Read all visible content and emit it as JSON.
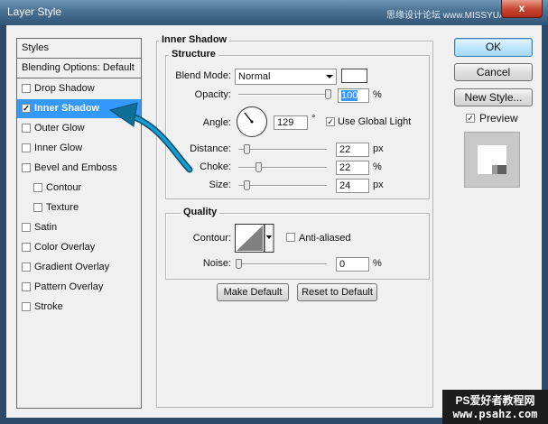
{
  "window": {
    "title": "Layer Style",
    "watermark": "思缘设计论坛  www.MISSYUAN.COM",
    "close_glyph": "x"
  },
  "styles_panel": {
    "header": "Styles",
    "blending": "Blending Options: Default",
    "items": [
      {
        "label": "Drop Shadow",
        "checked": false
      },
      {
        "label": "Inner Shadow",
        "checked": true,
        "selected": true
      },
      {
        "label": "Outer Glow",
        "checked": false
      },
      {
        "label": "Inner Glow",
        "checked": false
      },
      {
        "label": "Bevel and Emboss",
        "checked": false
      },
      {
        "label": "Contour",
        "checked": false,
        "indent": true
      },
      {
        "label": "Texture",
        "checked": false,
        "indent": true
      },
      {
        "label": "Satin",
        "checked": false
      },
      {
        "label": "Color Overlay",
        "checked": false
      },
      {
        "label": "Gradient Overlay",
        "checked": false
      },
      {
        "label": "Pattern Overlay",
        "checked": false
      },
      {
        "label": "Stroke",
        "checked": false
      }
    ]
  },
  "inner_shadow": {
    "title": "Inner Shadow",
    "structure": {
      "title": "Structure",
      "blend_mode_label": "Blend Mode:",
      "blend_mode_value": "Normal",
      "shadow_color": "#ffffff",
      "opacity_label": "Opacity:",
      "opacity_value": "100",
      "opacity_unit": "%",
      "opacity_level": 1.0,
      "angle_label": "Angle:",
      "angle_value": "129",
      "angle_unit": "°",
      "angle_degrees": 129,
      "use_global_light_label": "Use Global Light",
      "use_global_light": true,
      "distance_label": "Distance:",
      "distance_value": "22",
      "distance_unit": "px",
      "distance_level": 0.09,
      "choke_label": "Choke:",
      "choke_value": "22",
      "choke_unit": "%",
      "choke_level": 0.22,
      "size_label": "Size:",
      "size_value": "24",
      "size_unit": "px",
      "size_level": 0.09
    },
    "quality": {
      "title": "Quality",
      "contour_label": "Contour:",
      "anti_aliased_label": "Anti-aliased",
      "anti_aliased": false,
      "noise_label": "Noise:",
      "noise_value": "0",
      "noise_unit": "%",
      "noise_level": 0.0
    },
    "make_default": "Make Default",
    "reset_default": "Reset to Default"
  },
  "buttons": {
    "ok": "OK",
    "cancel": "Cancel",
    "new_style": "New Style...",
    "preview_label": "Preview",
    "preview_checked": true
  },
  "badge": {
    "line1": "PS爱好者教程网",
    "line2": "www.psahz.com"
  },
  "colors": {
    "selection": "#3399ff",
    "arrow": "#1a9bd0",
    "titlebar": "#4a7092"
  }
}
